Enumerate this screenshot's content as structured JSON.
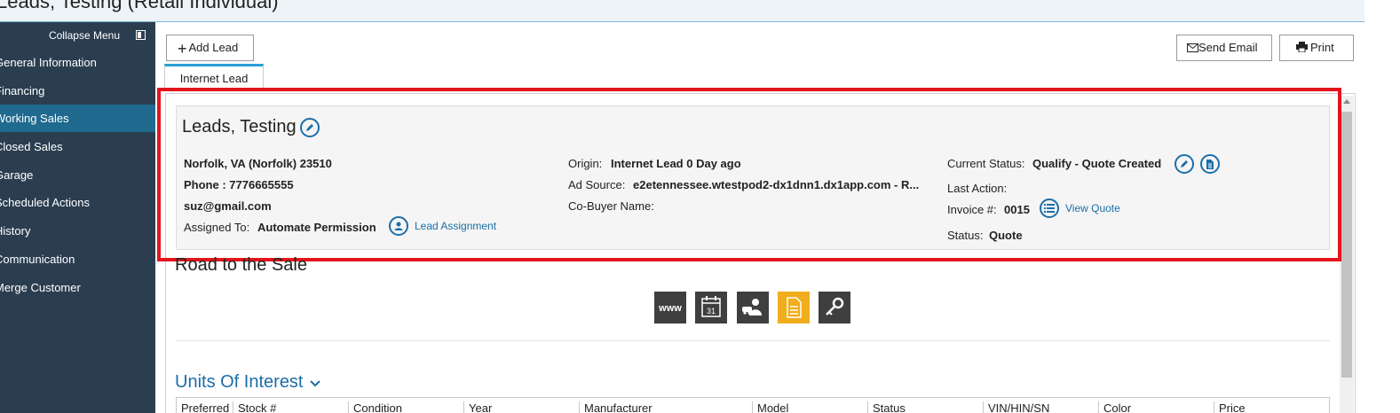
{
  "page": {
    "title": "Leads, Testing (Retail Individual)"
  },
  "sidebar": {
    "collapse_label": "Collapse Menu",
    "items": [
      {
        "label": "General Information",
        "active": false
      },
      {
        "label": "Financing",
        "active": false
      },
      {
        "label": "Working Sales",
        "active": true
      },
      {
        "label": "Closed Sales",
        "active": false
      },
      {
        "label": "Garage",
        "active": false
      },
      {
        "label": "Scheduled Actions",
        "active": false
      },
      {
        "label": "History",
        "active": false
      },
      {
        "label": "Communication",
        "active": false
      },
      {
        "label": "Merge Customer",
        "active": false
      }
    ]
  },
  "toolbar": {
    "add_lead": "Add Lead",
    "send_email": "Send Email",
    "print": "Print"
  },
  "tabs": [
    {
      "label": "Internet Lead",
      "active": true
    }
  ],
  "lead": {
    "name": "Leads, Testing",
    "location": "Norfolk, VA (Norfolk) 23510",
    "phone": "Phone : 7776665555",
    "email": "suz@gmail.com",
    "assigned_label": "Assigned To:",
    "assigned_value": "Automate Permission",
    "lead_assignment_link": "Lead Assignment",
    "origin_label": "Origin:",
    "origin_value": "Internet Lead 0 Day ago",
    "ad_source_label": "Ad Source:",
    "ad_source_value": "e2etennessee.wtestpod2-dx1dnn1.dx1app.com - R...",
    "cobuyer_label": "Co-Buyer Name:",
    "current_status_label": "Current Status:",
    "current_status_value": "Qualify - Quote Created",
    "last_action_label": "Last Action:",
    "invoice_label": "Invoice #:",
    "invoice_value": "0015",
    "view_quote_link": "View Quote",
    "status_label": "Status:",
    "status_value": "Quote"
  },
  "road_to_sale": {
    "title": "Road to the Sale",
    "steps": [
      {
        "icon": "www-icon",
        "text": "www",
        "active": false
      },
      {
        "icon": "calendar-icon",
        "text": "31",
        "active": false
      },
      {
        "icon": "customer-vehicle-icon",
        "active": false
      },
      {
        "icon": "document-icon",
        "active": true
      },
      {
        "icon": "key-icon",
        "active": false
      }
    ]
  },
  "units_of_interest": {
    "title": "Units Of Interest",
    "columns": [
      "Preferred",
      "Stock #",
      "Condition",
      "Year",
      "Manufacturer",
      "Model",
      "Status",
      "VIN/HIN/SN",
      "Color",
      "Price"
    ]
  },
  "colors": {
    "sidebar_bg": "#2b3e50",
    "sidebar_active": "#1f6a8e",
    "link": "#1b6ea8",
    "highlight": "#e3141c",
    "active_step": "#f0ad1c"
  }
}
